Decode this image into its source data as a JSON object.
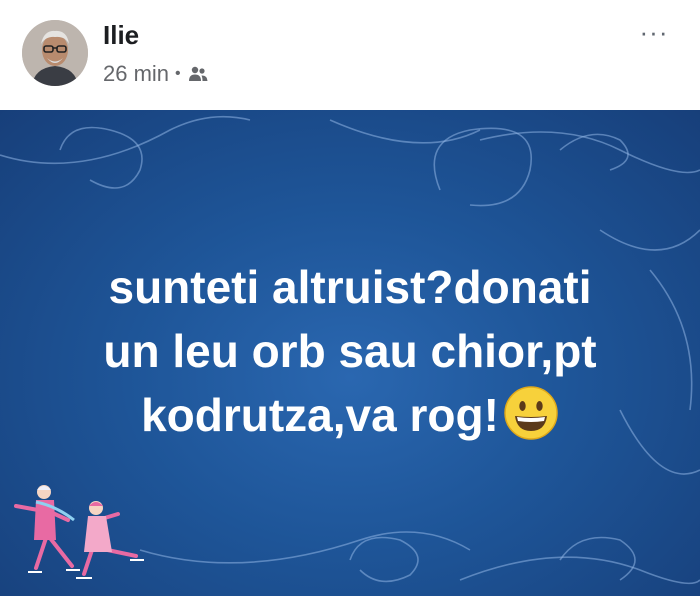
{
  "post": {
    "author": "Ilie",
    "time": "26 min",
    "separator": "•",
    "audience_icon": "friends-icon",
    "menu_label": "···",
    "text_lines": [
      "sunteti altruist?donati",
      "un leu orb sau chior,pt",
      "kodrutza,va rog!"
    ],
    "emoji": "grinning-face-emoji",
    "background": {
      "colors": [
        "#2a67b0",
        "#1e5598",
        "#173f7a"
      ],
      "theme": "ice-skating"
    }
  }
}
